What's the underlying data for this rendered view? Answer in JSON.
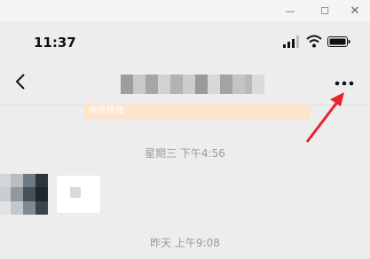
{
  "window_controls": {
    "minimize": "—",
    "maximize": "☐",
    "close": "✕"
  },
  "status_bar": {
    "time": "11:37"
  },
  "nav": {
    "back_icon": "chevron-left-icon",
    "more_icon": "more-dots-icon"
  },
  "banner": {
    "text": "微信转账"
  },
  "timestamps": [
    "星期三 下午4:56",
    "昨天 上午9:08"
  ],
  "colors": {
    "background": "#ededed",
    "banner_bg": "#fde4cc",
    "arrow_red": "#e5252a",
    "timestamp_text": "#9a9a9a"
  }
}
